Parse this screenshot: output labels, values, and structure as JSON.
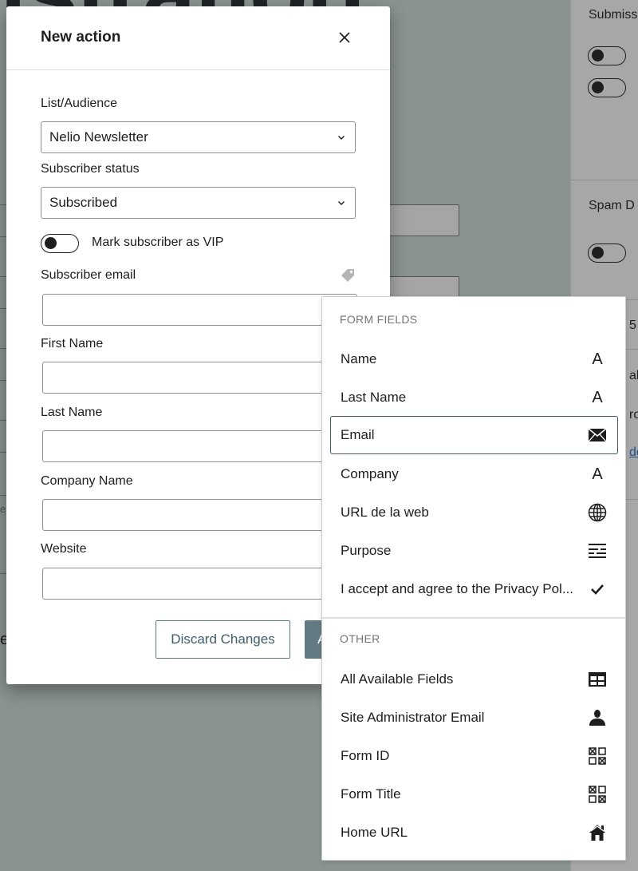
{
  "background": {
    "headline": "istration",
    "sidebar": {
      "sections": [
        {
          "title": "Submiss",
          "toggles": 2
        },
        {
          "title": "Spam D",
          "toggles": 1
        }
      ],
      "fragments": [
        "5",
        "ali",
        "ro",
        "de"
      ]
    },
    "left_fragments": [
      "e",
      "e"
    ]
  },
  "modal": {
    "title": "New action",
    "close_label": "Close",
    "fields": {
      "list_audience": {
        "label": "List/Audience",
        "value": "Nelio Newsletter"
      },
      "subscriber_status": {
        "label": "Subscriber status",
        "value": "Subscribed"
      },
      "vip_toggle": {
        "label": "Mark subscriber as VIP",
        "checked": false
      },
      "subscriber_email": {
        "label": "Subscriber email",
        "value": ""
      },
      "first_name": {
        "label": "First Name",
        "value": ""
      },
      "last_name": {
        "label": "Last Name",
        "value": ""
      },
      "company_name": {
        "label": "Company Name",
        "value": ""
      },
      "website": {
        "label": "Website",
        "value": ""
      }
    },
    "buttons": {
      "discard": "Discard Changes",
      "primary": "A"
    }
  },
  "dropdown": {
    "groups": [
      {
        "title": "FORM FIELDS",
        "items": [
          {
            "label": "Name",
            "icon": "text-icon"
          },
          {
            "label": "Last Name",
            "icon": "text-icon"
          },
          {
            "label": "Email",
            "icon": "envelope-icon",
            "focused": true
          },
          {
            "label": "Company",
            "icon": "text-icon"
          },
          {
            "label": "URL de la web",
            "icon": "globe-icon"
          },
          {
            "label": "Purpose",
            "icon": "paragraph-icon"
          },
          {
            "label": "I accept and agree to the Privacy Pol...",
            "icon": "checkmark-icon"
          }
        ]
      },
      {
        "title": "OTHER",
        "items": [
          {
            "label": "All Available Fields",
            "icon": "table-icon"
          },
          {
            "label": "Site Administrator Email",
            "icon": "person-icon"
          },
          {
            "label": "Form ID",
            "icon": "grid-icon"
          },
          {
            "label": "Form Title",
            "icon": "grid-icon"
          },
          {
            "label": "Home URL",
            "icon": "home-icon"
          }
        ]
      }
    ]
  }
}
